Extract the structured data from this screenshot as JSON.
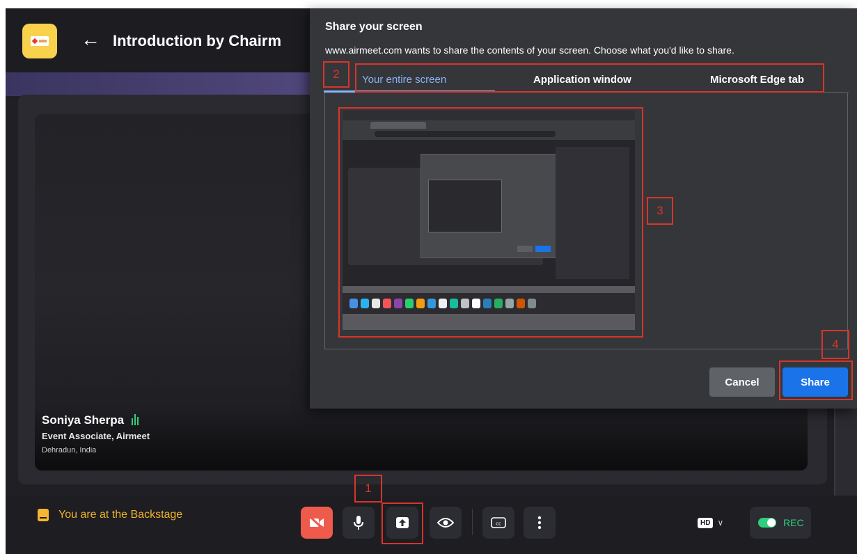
{
  "app": {
    "session_title": "Introduction by Chairm",
    "speaker": {
      "name": "Soniya Sherpa",
      "role": "Event Associate, Airmeet",
      "location": "Dehradun, India"
    },
    "backstage_text": "You are at the Backstage",
    "quality_badge": "HD",
    "rec_label": "REC",
    "colors": {
      "camera_off": "#ee5b4c",
      "backstage": "#f0b429",
      "rec": "#2dd07c"
    },
    "controls": [
      {
        "name": "camera-off",
        "icon": "video-off-icon"
      },
      {
        "name": "microphone",
        "icon": "mic-icon"
      },
      {
        "name": "share-screen",
        "icon": "upload-arrow-icon"
      },
      {
        "name": "view",
        "icon": "eye-icon"
      },
      {
        "name": "captions",
        "icon": "cc-icon"
      },
      {
        "name": "more",
        "icon": "more-vertical-icon"
      }
    ]
  },
  "dialog": {
    "title": "Share your screen",
    "description": "www.airmeet.com wants to share the contents of your screen. Choose what you'd like to share.",
    "tabs": [
      {
        "label": "Your entire screen",
        "active": true
      },
      {
        "label": "Application window",
        "active": false
      },
      {
        "label": "Microsoft Edge tab",
        "active": false
      }
    ],
    "cancel_label": "Cancel",
    "share_label": "Share",
    "accent": "#8ab4f8",
    "primary": "#1a73e8"
  },
  "annotations": {
    "step1": "1",
    "step2": "2",
    "step3": "3",
    "step4": "4",
    "color": "#d8352a"
  }
}
